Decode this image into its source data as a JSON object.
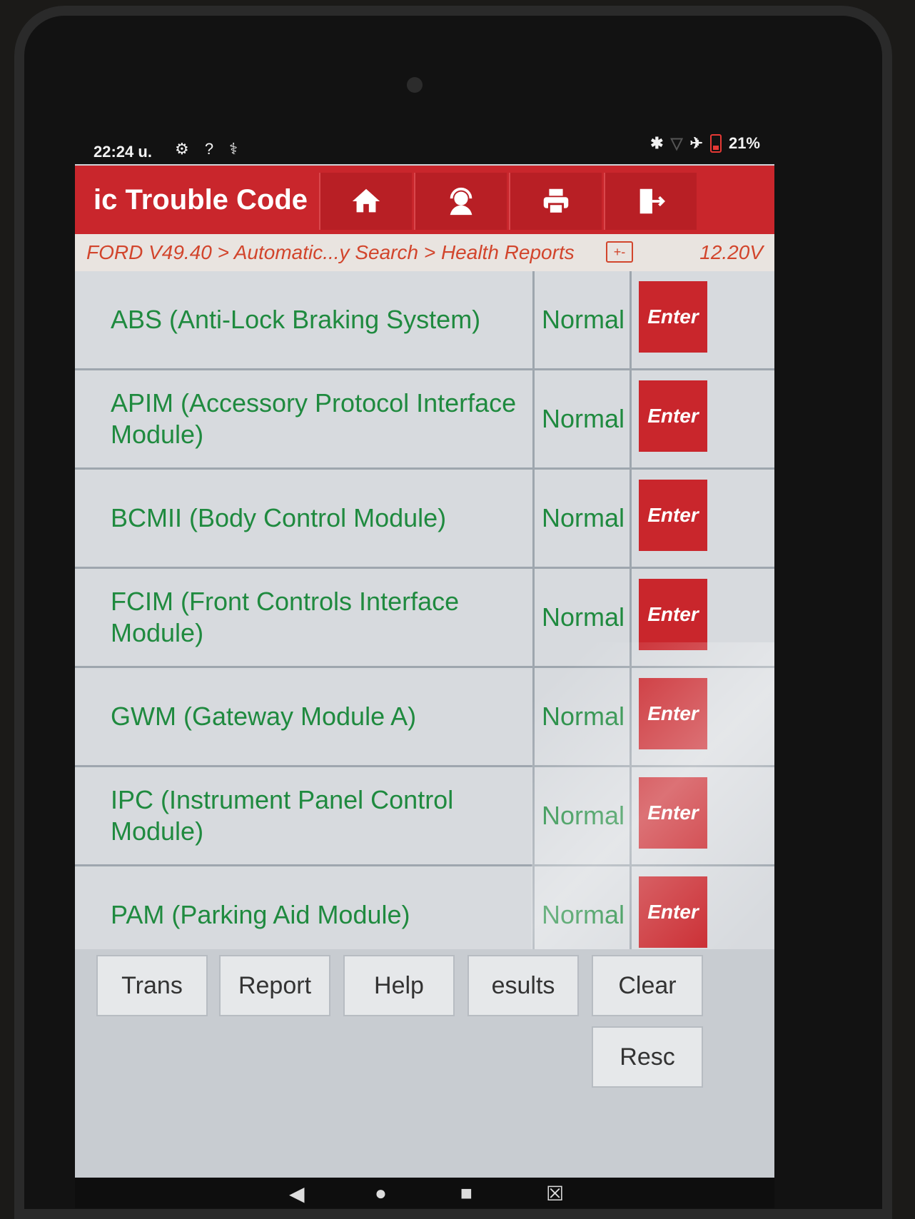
{
  "status_bar": {
    "time": "22:24 u.",
    "battery": "21%"
  },
  "header": {
    "title": "ic Trouble Code",
    "buttons": [
      {
        "icon": "home-icon"
      },
      {
        "icon": "support-agent-icon"
      },
      {
        "icon": "printer-icon"
      },
      {
        "icon": "exit-icon"
      }
    ]
  },
  "breadcrumb": {
    "path": "FORD V49.40 > Automatic...y Search > Health Reports",
    "battery_symbol": "+-",
    "voltage": "12.20V"
  },
  "modules": [
    {
      "name": "ABS (Anti-Lock Braking System)",
      "status": "Normal",
      "action": "Enter"
    },
    {
      "name": "APIM (Accessory Protocol Interface Module)",
      "status": "Normal",
      "action": "Enter"
    },
    {
      "name": "BCMII (Body Control Module)",
      "status": "Normal",
      "action": "Enter"
    },
    {
      "name": "FCIM (Front Controls Interface Module)",
      "status": "Normal",
      "action": "Enter"
    },
    {
      "name": "GWM (Gateway Module A)",
      "status": "Normal",
      "action": "Enter"
    },
    {
      "name": "IPC (Instrument Panel Control Module)",
      "status": "Normal",
      "action": "Enter"
    },
    {
      "name": "PAM (Parking Aid Module)",
      "status": "Normal",
      "action": "Enter"
    }
  ],
  "bottom_buttons": {
    "trans": "Trans",
    "report": "Report",
    "help": "Help",
    "results": "esults",
    "clear": "Clear",
    "resc": "Resc"
  },
  "accent_color": "#c9262c",
  "status_color": "#1f8a3f"
}
